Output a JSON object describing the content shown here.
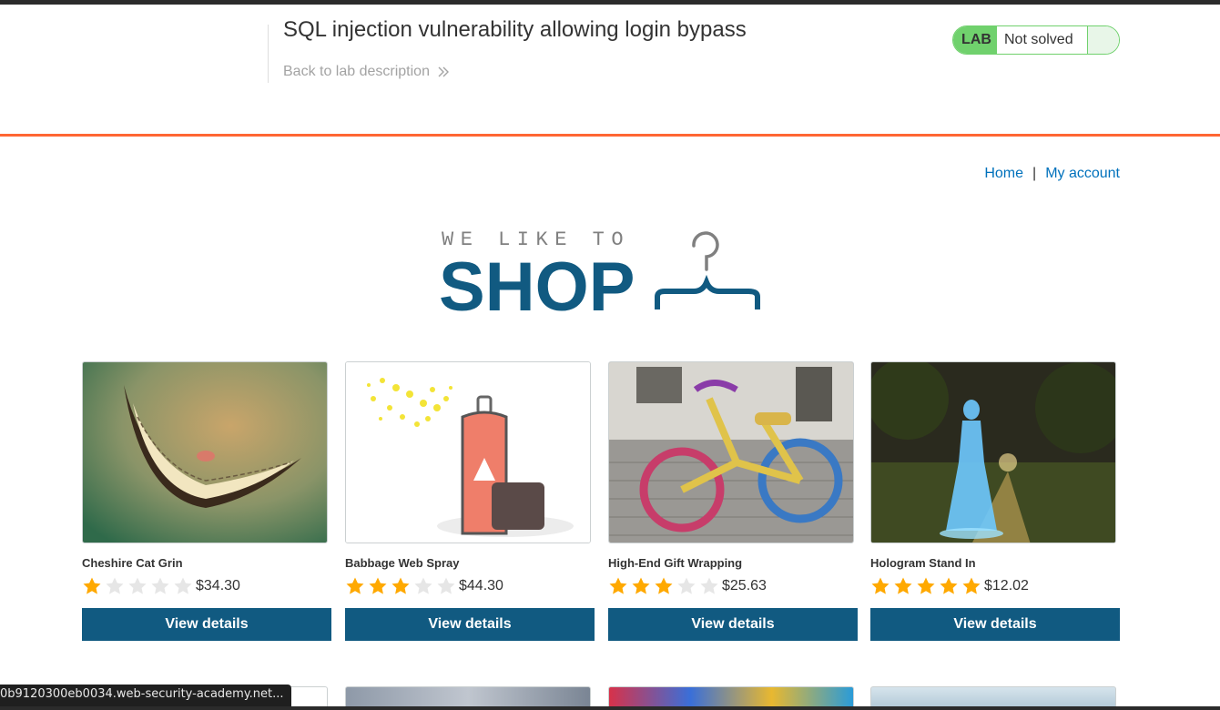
{
  "lab": {
    "title": "SQL injection vulnerability allowing login bypass",
    "back_label": "Back to lab description",
    "badge": "LAB",
    "status": "Not solved"
  },
  "nav": {
    "home": "Home",
    "separator": "|",
    "account": "My account"
  },
  "logo": {
    "line1": "WE LIKE TO",
    "line2": "SHOP"
  },
  "products": [
    {
      "name": "Cheshire Cat Grin",
      "rating": 1,
      "price": "$34.30",
      "button": "View details",
      "image": "cheshire-grin"
    },
    {
      "name": "Babbage Web Spray",
      "rating": 3,
      "price": "$44.30",
      "button": "View details",
      "image": "spray-can"
    },
    {
      "name": "High-End Gift Wrapping",
      "rating": 3,
      "price": "$25.63",
      "button": "View details",
      "image": "knitted-bicycle"
    },
    {
      "name": "Hologram Stand In",
      "rating": 5,
      "price": "$12.02",
      "button": "View details",
      "image": "hologram-woman"
    }
  ],
  "status_url": "0b9120300eb0034.web-security-academy.net...",
  "colors": {
    "accent_orange": "#ff6633",
    "button_blue": "#115a81",
    "link_blue": "#0071bc",
    "lab_green": "#70d16d",
    "star_gold": "#ffa900",
    "star_empty": "#e6e6e6"
  }
}
